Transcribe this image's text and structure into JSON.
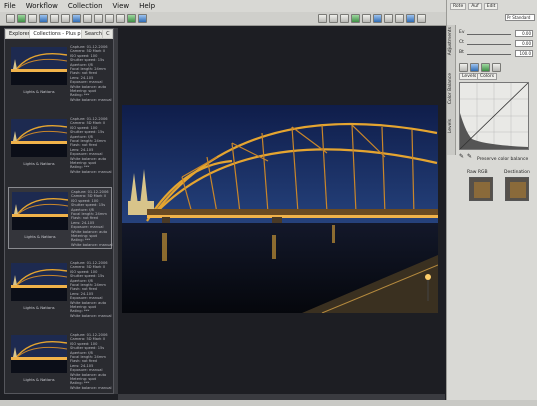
{
  "menu": [
    "File",
    "Workflow",
    "Collection",
    "View",
    "Help"
  ],
  "browser": {
    "tabs": [
      "Explorer",
      "Collections - Plus pict",
      "Search",
      "C"
    ],
    "thumbnails": [
      {
        "caption": "Lights & Nations",
        "meta": [
          "Capture: 01-12-2006",
          "Camera: 5D Mark II",
          "ISO speed: 100",
          "Shutter speed: 15s",
          "Aperture: f/8",
          "Focal length: 24mm",
          "Flash: not fired",
          "Lens: 24-105",
          "Exposure: manual",
          "White balance: auto",
          "Metering: spot",
          "Rating: ***",
          "White balance: manual"
        ]
      },
      {
        "caption": "Lights & Nations",
        "meta": [
          "Capture: 01-12-2006",
          "Camera: 5D Mark II",
          "ISO speed: 100",
          "Shutter speed: 15s",
          "Aperture: f/8",
          "Focal length: 24mm",
          "Flash: not fired",
          "Lens: 24-105",
          "Exposure: manual",
          "White balance: auto",
          "Metering: spot",
          "Rating: ***",
          "White balance: manual"
        ]
      },
      {
        "caption": "Lights & Nations",
        "meta": [
          "Capture: 01-12-2006",
          "Camera: 5D Mark II",
          "ISO speed: 100",
          "Shutter speed: 15s",
          "Aperture: f/8",
          "Focal length: 24mm",
          "Flash: not fired",
          "Lens: 24-105",
          "Exposure: manual",
          "White balance: auto",
          "Metering: spot",
          "Rating: ***",
          "White balance: manual"
        ]
      },
      {
        "caption": "Lights & Nations",
        "meta": [
          "Capture: 01-12-2006",
          "Camera: 5D Mark II",
          "ISO speed: 100",
          "Shutter speed: 15s",
          "Aperture: f/8",
          "Focal length: 24mm",
          "Flash: not fired",
          "Lens: 24-105",
          "Exposure: manual",
          "White balance: auto",
          "Metering: spot",
          "Rating: ***",
          "White balance: manual"
        ]
      },
      {
        "caption": "Lights & Nations",
        "meta": [
          "Capture: 01-12-2006",
          "Camera: 5D Mark II",
          "ISO speed: 100",
          "Shutter speed: 15s",
          "Aperture: f/8",
          "Focal length: 24mm",
          "Flash: not fired",
          "Lens: 24-105",
          "Exposure: manual",
          "White balance: auto",
          "Metering: spot",
          "Rating: ***",
          "White balance: manual"
        ]
      }
    ]
  },
  "right_panel": {
    "top_tabs": [
      "Rote",
      "Auf",
      "Edit"
    ],
    "preset": "Pr Standard",
    "vertical_tabs": [
      "Adjustments",
      "Color Balance",
      "Levels"
    ],
    "sliders": [
      {
        "label": "Ev",
        "value": "0.00"
      },
      {
        "label": "Ct",
        "value": "0.00"
      },
      {
        "label": "Bt",
        "value": "100.0"
      }
    ],
    "levels_tabs": [
      "Levels",
      "Colors"
    ],
    "preserve": "Preserve color balance",
    "raw_label": "Raw RGB",
    "dest_label": "Destination"
  },
  "colors": {
    "accent": "#f2b33b",
    "sky": "#1b2a55",
    "water": "#0a0d18"
  }
}
